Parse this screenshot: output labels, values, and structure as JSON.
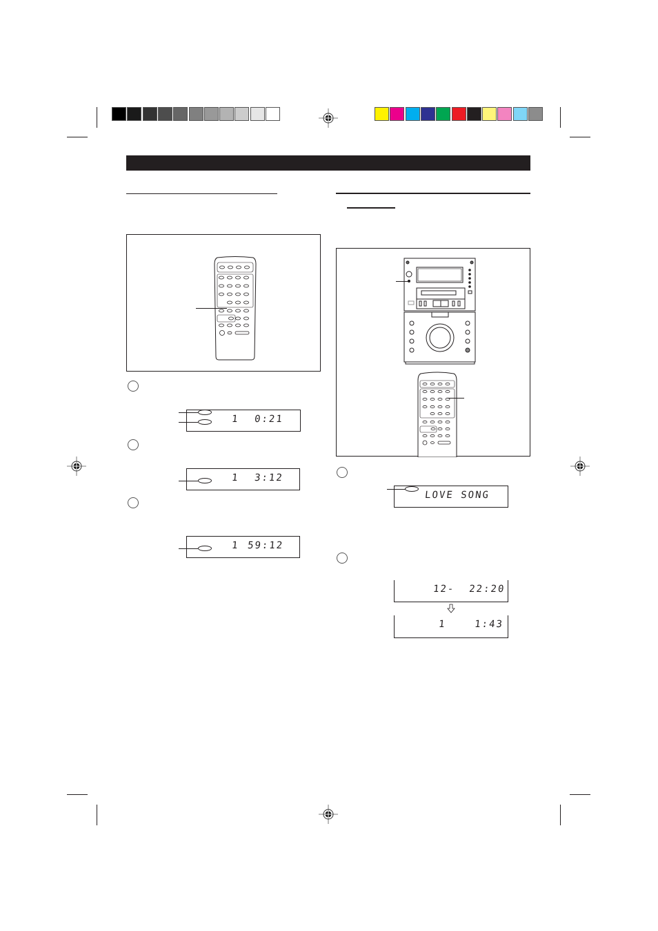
{
  "print_marks": {
    "grayscale_swatches": [
      "#000000",
      "#1a1a1a",
      "#333333",
      "#4d4d4d",
      "#666666",
      "#808080",
      "#999999",
      "#b3b3b3",
      "#cccccc",
      "#e6e6e6",
      "#ffffff"
    ],
    "color_swatches": [
      "#fff200",
      "#ec008c",
      "#00aeef",
      "#2e3192",
      "#00a651",
      "#ed1c24",
      "#231f20",
      "#fff57a",
      "#f384c0",
      "#7fd6f7",
      "#8c8c8c"
    ]
  },
  "left_column": {
    "steps": [
      {
        "number": "",
        "display": {
          "track": "1",
          "time": "0:21"
        }
      },
      {
        "number": "",
        "display": {
          "track": "1",
          "time": "3:12"
        }
      },
      {
        "number": "",
        "display": {
          "track": "1",
          "time": "59:12"
        }
      }
    ]
  },
  "right_column": {
    "steps": [
      {
        "number": "",
        "display": {
          "text": "LOVE SONG"
        }
      },
      {
        "number": "",
        "displays": [
          {
            "text": "12-  22:20"
          },
          {
            "text": "1    1:43"
          }
        ]
      }
    ]
  }
}
